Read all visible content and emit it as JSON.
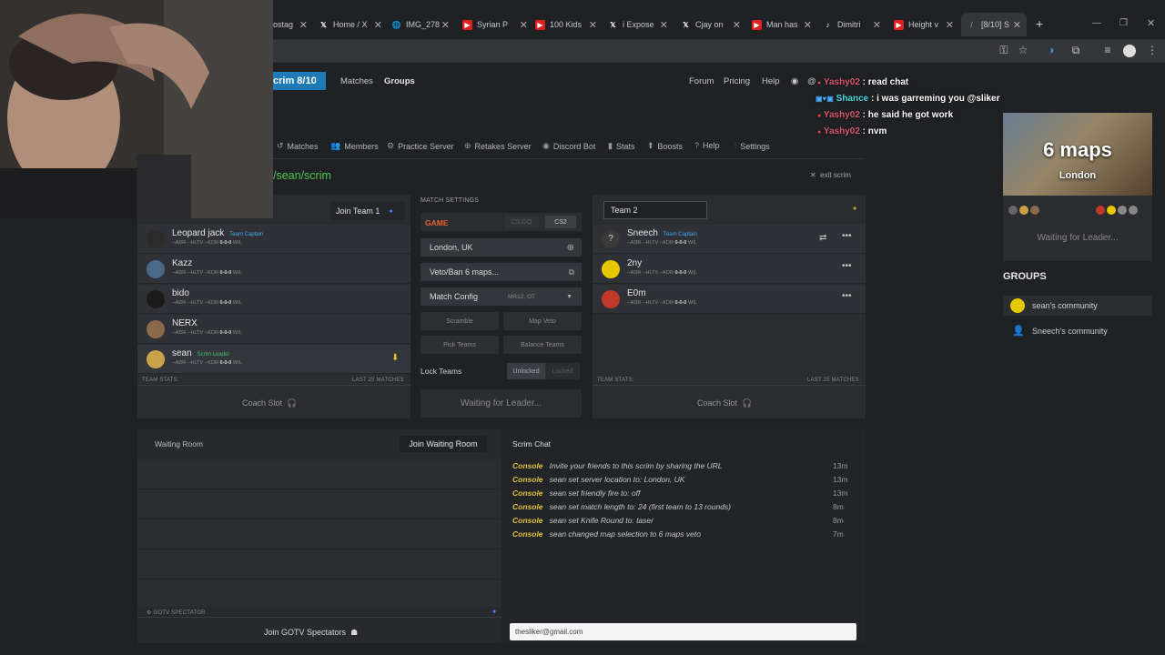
{
  "tabs": [
    {
      "label": "ostag",
      "icon": "tab-icon"
    },
    {
      "label": "Home / X",
      "icon": "x-icon"
    },
    {
      "label": "IMG_278",
      "icon": "globe-icon"
    },
    {
      "label": "Syrian P",
      "icon": "youtube-icon"
    },
    {
      "label": "100 Kids",
      "icon": "youtube-icon"
    },
    {
      "label": "i Expose",
      "icon": "x-icon"
    },
    {
      "label": "Cjay on",
      "icon": "x-icon"
    },
    {
      "label": "Man has",
      "icon": "youtube-icon"
    },
    {
      "label": "Dimitri",
      "icon": "tiktok-icon"
    },
    {
      "label": "Height v",
      "icon": "youtube-icon"
    },
    {
      "label": "[8/10] S",
      "icon": "site-icon"
    }
  ],
  "nav": {
    "brand": "crim 8/10",
    "matches": "Matches",
    "groups": "Groups",
    "forum": "Forum",
    "pricing": "Pricing",
    "help": "Help",
    "user": "@"
  },
  "subnav": [
    "Matches",
    "Members",
    "Practice Server",
    "Retakes Server",
    "Discord Bot",
    "Stats",
    "Boosts",
    "Help",
    "Settings"
  ],
  "path": "/sean/scrim",
  "exit_scrim": "exit scrim",
  "team1": {
    "join_label": "Join Team 1",
    "players": [
      {
        "name": "Leopard jack",
        "badge": "Team Captain",
        "stats": "--ADR  --HLTV  --KDR",
        "wl": "0-0-0",
        "wl_suffix": "W/L"
      },
      {
        "name": "Kazz",
        "badge": "",
        "stats": "--ADR  --HLTV  --KDR",
        "wl": "0-0-0",
        "wl_suffix": "W/L"
      },
      {
        "name": "bido",
        "badge": "",
        "stats": "--ADR  --HLTV  --KDR",
        "wl": "0-0-0",
        "wl_suffix": "W/L"
      },
      {
        "name": "NERX",
        "badge": "",
        "stats": "--ADR  --HLTV  --KDR",
        "wl": "0-0-0",
        "wl_suffix": "W/L"
      },
      {
        "name": "sean",
        "badge": "Scrim Leader",
        "stats": "--ADR  --HLTV  --KDR",
        "wl": "0-0-0",
        "wl_suffix": "W/L"
      }
    ],
    "team_stats": "TEAM STATS:",
    "last_matches": "LAST 25 MATCHES",
    "coach": "Coach Slot"
  },
  "settings": {
    "heading": "MATCH SETTINGS",
    "game_label": "GAME",
    "game_options": [
      "CS:GO",
      "CS2"
    ],
    "location": "London, UK",
    "veto": "Veto/Ban 6 maps...",
    "match_config": "Match Config",
    "match_config_value": "MR12, OT",
    "scramble": "Scramble",
    "map_veto": "Map Veto",
    "pick_teams": "Pick Teams",
    "balance_teams": "Balance Teams",
    "lock_teams": "Lock Teams",
    "unlocked": "Unlocked",
    "locked": "Locked",
    "waiting": "Waiting for Leader..."
  },
  "team2": {
    "name_value": "Team 2",
    "players": [
      {
        "name": "Sneech",
        "badge": "Team Captain",
        "stats": "--ADR  --HLTV  --KDR",
        "wl": "0-0-0",
        "wl_suffix": "W/L"
      },
      {
        "name": "2ny",
        "badge": "",
        "stats": "--ADR  --HLTV  --KDR",
        "wl": "0-0-0",
        "wl_suffix": "W/L"
      },
      {
        "name": "E0m",
        "badge": "",
        "stats": "--ADR  --HLTV  --KDR",
        "wl": "0-0-0",
        "wl_suffix": "W/L"
      }
    ],
    "team_stats": "TEAM STATS:",
    "last_matches": "LAST 25 MATCHES",
    "coach": "Coach Slot"
  },
  "waiting_room": {
    "title": "Waiting Room",
    "join": "Join Waiting Room",
    "gotv_label": "GOTV SPECTATOR",
    "join_gotv": "Join GOTV Spectators"
  },
  "chat": {
    "title": "Scrim Chat",
    "lines": [
      {
        "source": "Console",
        "text": "Invite your friends to this scrim by sharing the URL",
        "time": "13m"
      },
      {
        "source": "Console",
        "text": "sean set server location to: London, UK",
        "time": "13m"
      },
      {
        "source": "Console",
        "text": "sean set friendly fire to: off",
        "time": "13m"
      },
      {
        "source": "Console",
        "text": "sean set match length to: 24 (first team to 13 rounds)",
        "time": "8m"
      },
      {
        "source": "Console",
        "text": "sean set Knife Round to: taser",
        "time": "8m"
      },
      {
        "source": "Console",
        "text": "sean changed map selection to 6 maps veto",
        "time": "7m"
      }
    ],
    "input_value": "thesliker@gmail.com"
  },
  "sidebar": {
    "map_title": "6 maps",
    "map_sub": "London",
    "waiting": "Waiting for Leader...",
    "groups_heading": "GROUPS",
    "groups": [
      "sean's community",
      "Sneech's community"
    ]
  },
  "stream_chat": [
    {
      "user": "Yashy02",
      "msg": "read chat"
    },
    {
      "user": "Shance",
      "msg": "i was garreming you @sliker"
    },
    {
      "user": "Yashy02",
      "msg": "he said he got work"
    },
    {
      "user": "Yashy02",
      "msg": "nvm"
    }
  ],
  "colors": {
    "brand": "#1f7ab8",
    "captain_badge": "#3fa9f5",
    "leader_badge": "#45c06a",
    "console": "#e0c23c",
    "game_label": "#e8622c",
    "path": "#4cc94c",
    "chat_user": "#d65a6e"
  }
}
